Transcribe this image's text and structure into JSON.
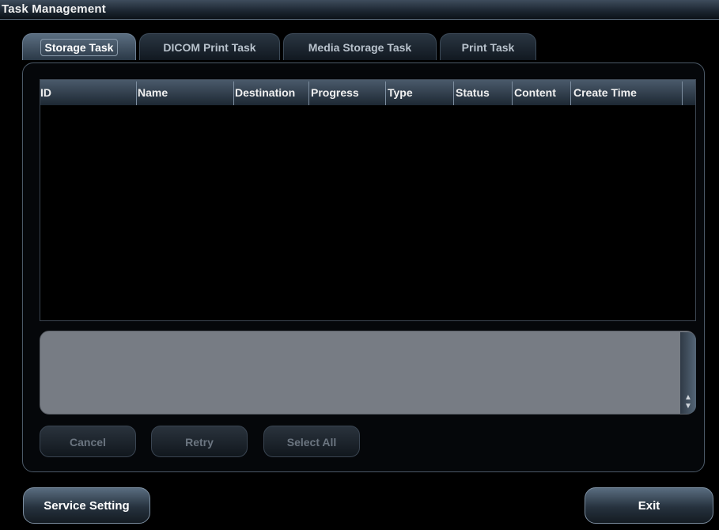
{
  "window": {
    "title": "Task Management"
  },
  "tabs": [
    {
      "label": "Storage Task",
      "active": true
    },
    {
      "label": "DICOM Print Task",
      "active": false
    },
    {
      "label": "Media Storage Task",
      "active": false
    },
    {
      "label": "Print Task",
      "active": false
    }
  ],
  "table": {
    "columns": [
      "ID",
      "Name",
      "Destination",
      "Progress",
      "Type",
      "Status",
      "Content",
      "Create Time"
    ],
    "rows": []
  },
  "actions": {
    "cancel": "Cancel",
    "retry": "Retry",
    "select_all": "Select All",
    "enabled": false
  },
  "footer": {
    "service_setting": "Service Setting",
    "exit": "Exit"
  }
}
